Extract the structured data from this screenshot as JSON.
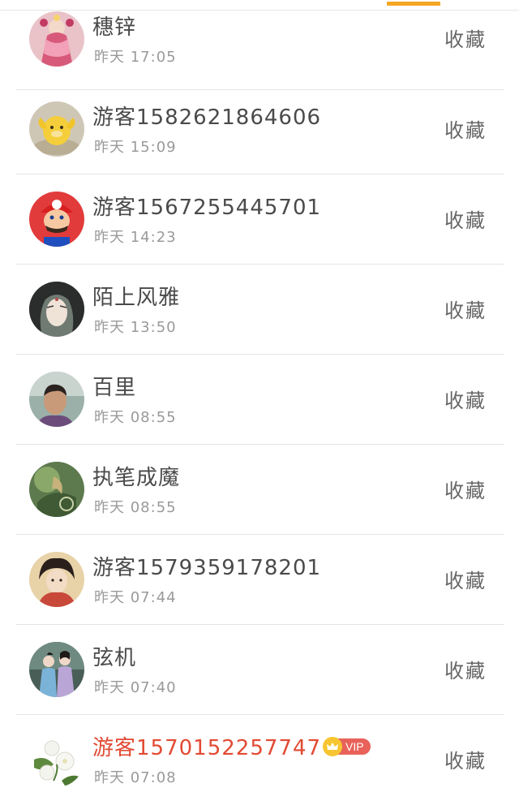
{
  "collect_label": "收藏",
  "vip_label": "VIP",
  "accent_color": "#f5a623",
  "vip_name_color": "#e24a33",
  "rows": [
    {
      "name": "穗锌",
      "time": "昨天 17:05",
      "avatar": "avatar-pink-costume",
      "vip": false
    },
    {
      "name": "游客1582621864606",
      "time": "昨天 15:09",
      "avatar": "avatar-yellow-duck",
      "vip": false
    },
    {
      "name": "游客1567255445701",
      "time": "昨天 14:23",
      "avatar": "avatar-mario",
      "vip": false
    },
    {
      "name": "陌上风雅",
      "time": "昨天 13:50",
      "avatar": "avatar-anime-face",
      "vip": false
    },
    {
      "name": "百里",
      "time": "昨天 08:55",
      "avatar": "avatar-man-photo",
      "vip": false
    },
    {
      "name": "执笔成魔",
      "time": "昨天 08:55",
      "avatar": "avatar-green-art",
      "vip": false
    },
    {
      "name": "游客1579359178201",
      "time": "昨天 07:44",
      "avatar": "avatar-ancient-woman",
      "vip": false
    },
    {
      "name": "弦机",
      "time": "昨天 07:40",
      "avatar": "avatar-couple",
      "vip": false
    },
    {
      "name": "游客1570152257747",
      "time": "昨天 07:08",
      "avatar": "avatar-white-flowers",
      "vip": true
    }
  ]
}
